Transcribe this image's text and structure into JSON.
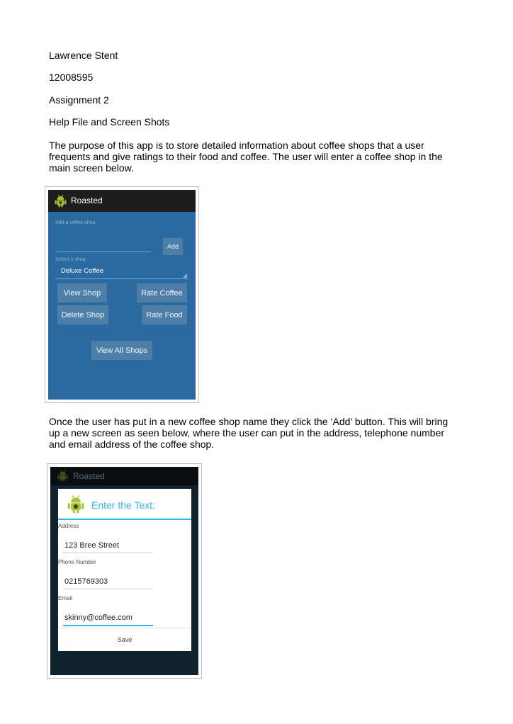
{
  "header": {
    "author": "Lawrence Stent",
    "student_id": "12008595",
    "assignment": "Assignment 2",
    "subtitle": "Help File and Screen Shots"
  },
  "paragraphs": {
    "intro": "The purpose of this app is to store detailed information about coffee shops that a user frequents and give ratings to their food and coffee. The user will enter a coffee shop in the main screen below.",
    "add_explanation": "Once the user has put in a new coffee shop name they click the ‘Add’ button. This will bring up a new screen as seen below, where the user can put in the address, telephone number and email address of the coffee shop."
  },
  "screenshot_main": {
    "app_title": "Roasted",
    "add_label": "Add a coffee shop:",
    "add_input_value": "",
    "add_button": "Add",
    "select_label": "Select a shop:",
    "selected_shop": "Deluxe Coffee",
    "buttons": {
      "view_shop": "View Shop",
      "rate_coffee": "Rate Coffee",
      "delete_shop": "Delete Shop",
      "rate_food": "Rate Food",
      "view_all_shops": "View All Shops"
    }
  },
  "screenshot_dialog": {
    "app_title": "Roasted",
    "dialog_title": "Enter the Text:",
    "fields": [
      {
        "label": "Address",
        "value": "123 Bree Street"
      },
      {
        "label": "Phone Number",
        "value": "0215769303"
      },
      {
        "label": "Email",
        "value": "skinny@coffee.com"
      }
    ],
    "save_button": "Save"
  },
  "colors": {
    "main_background": "#2a6aa1",
    "button": "#4d7ea8",
    "accent": "#33b5e5",
    "android_green": "#a4c639"
  },
  "icons": [
    "android-icon"
  ]
}
